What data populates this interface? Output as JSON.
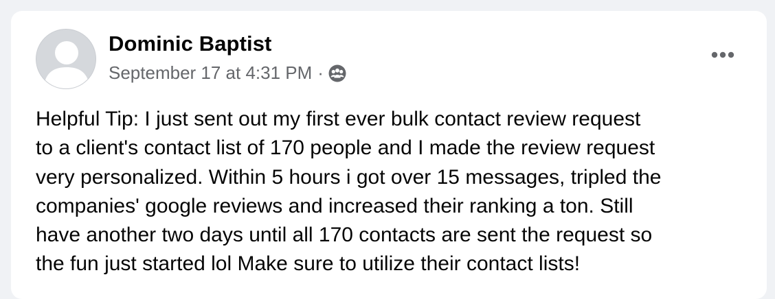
{
  "post": {
    "author_name": "Dominic Baptist",
    "timestamp": "September 17 at 4:31 PM",
    "separator": "·",
    "audience_icon": "group-icon",
    "more_icon": "more-options-icon",
    "body": "Helpful Tip: I just sent out my first ever bulk contact review request\nto a client's contact list of 170 people and I made the review request\nvery personalized. Within 5 hours i got over 15 messages, tripled the\ncompanies' google reviews and increased their ranking a ton. Still\nhave another two days until all 170 contacts are sent the request so\nthe fun just started lol Make sure to utilize their contact lists!"
  },
  "colors": {
    "page_background": "#f0f2f5",
    "card_background": "#ffffff",
    "primary_text": "#050505",
    "secondary_text": "#65676b",
    "avatar_placeholder": "#d5d8dc"
  }
}
